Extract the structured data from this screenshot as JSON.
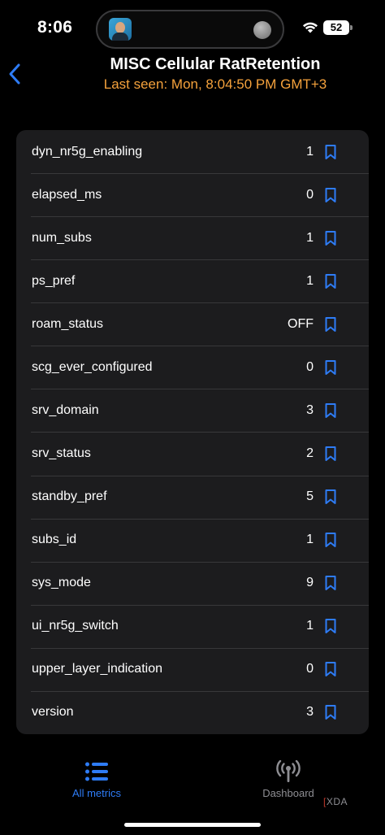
{
  "status_bar": {
    "time": "8:06",
    "battery": "52",
    "icons": [
      "wifi-icon",
      "battery-icon"
    ]
  },
  "header": {
    "title": "MISC Cellular RatRetention",
    "subtitle": "Last seen: Mon, 8:04:50 PM GMT+3",
    "subtitle_color": "#f5a23c",
    "back_icon": "chevron-left-icon"
  },
  "metrics": [
    {
      "label": "dyn_nr5g_enabling",
      "value": "1"
    },
    {
      "label": "elapsed_ms",
      "value": "0"
    },
    {
      "label": "num_subs",
      "value": "1"
    },
    {
      "label": "ps_pref",
      "value": "1"
    },
    {
      "label": "roam_status",
      "value": "OFF"
    },
    {
      "label": "scg_ever_configured",
      "value": "0"
    },
    {
      "label": "srv_domain",
      "value": "3"
    },
    {
      "label": "srv_status",
      "value": "2"
    },
    {
      "label": "standby_pref",
      "value": "5"
    },
    {
      "label": "subs_id",
      "value": "1"
    },
    {
      "label": "sys_mode",
      "value": "9"
    },
    {
      "label": "ui_nr5g_switch",
      "value": "1"
    },
    {
      "label": "upper_layer_indication",
      "value": "0"
    },
    {
      "label": "version",
      "value": "3"
    }
  ],
  "tabbar": {
    "all_metrics": "All metrics",
    "dashboard": "Dashboard",
    "active_color": "#2e7cf6",
    "inactive_color": "#8e8e93"
  },
  "watermark": "XDA",
  "accent_color": "#2e7cf6"
}
